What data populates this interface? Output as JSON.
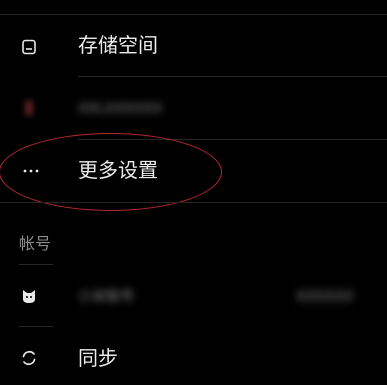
{
  "settings": {
    "storage": {
      "label": "存储空间",
      "icon": "storage-icon"
    },
    "obscured_row": {
      "label": "XXLXXXXXX",
      "icon": "app-icon"
    },
    "more_settings": {
      "label": "更多设置",
      "icon": "more-dots-icon"
    },
    "account_section": {
      "header": "帐号"
    },
    "account_row": {
      "label": "小米账号",
      "value": "XXXXXX",
      "icon": "mi-cat-icon"
    },
    "sync": {
      "label": "同步",
      "icon": "sync-icon"
    }
  },
  "colors": {
    "background": "#000000",
    "divider": "#262626",
    "annotation": "#b5292a"
  }
}
